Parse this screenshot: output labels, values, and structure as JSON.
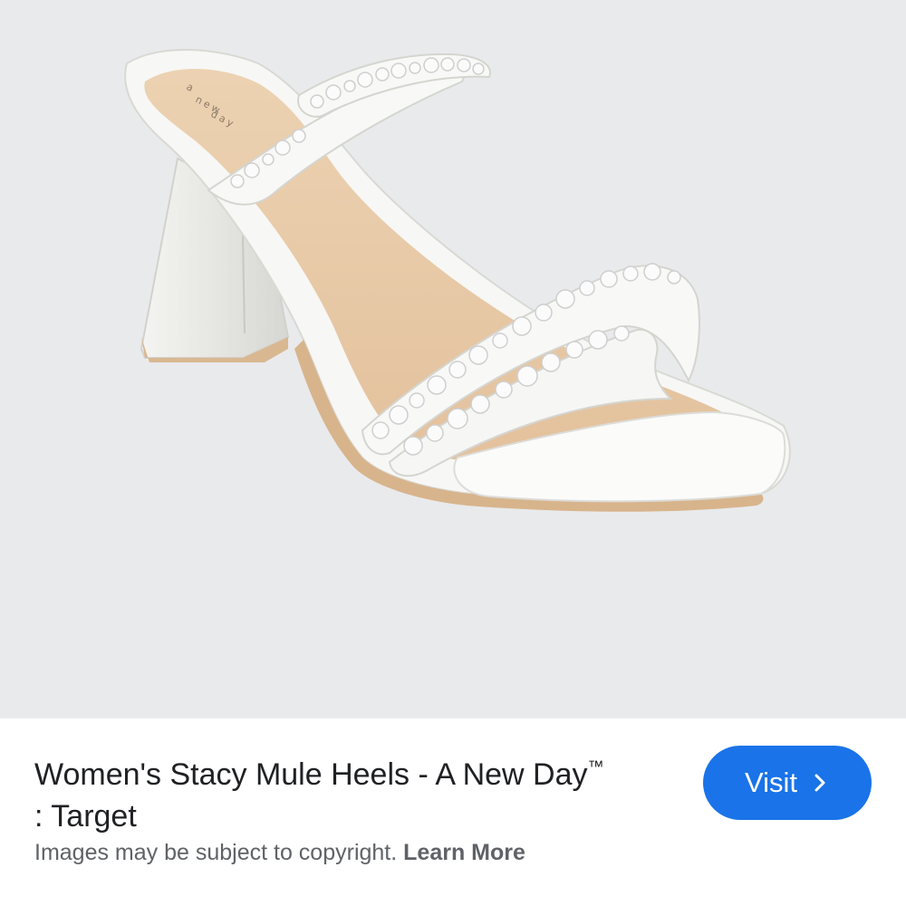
{
  "product_image": {
    "icon": "sandal-image",
    "background_color": "#e9eaec",
    "insole_brand_text": "a new day"
  },
  "result": {
    "title_line1": "Women's Stacy Mule Heels - A New Day",
    "trademark": "™",
    "title_line2": ": Target"
  },
  "visit_button": {
    "label": "Visit",
    "icon": "chevron-right-icon",
    "color": "#1a73e8"
  },
  "footer": {
    "copyright_text": "Images may be subject to copyright.",
    "learn_more_label": "Learn More"
  }
}
